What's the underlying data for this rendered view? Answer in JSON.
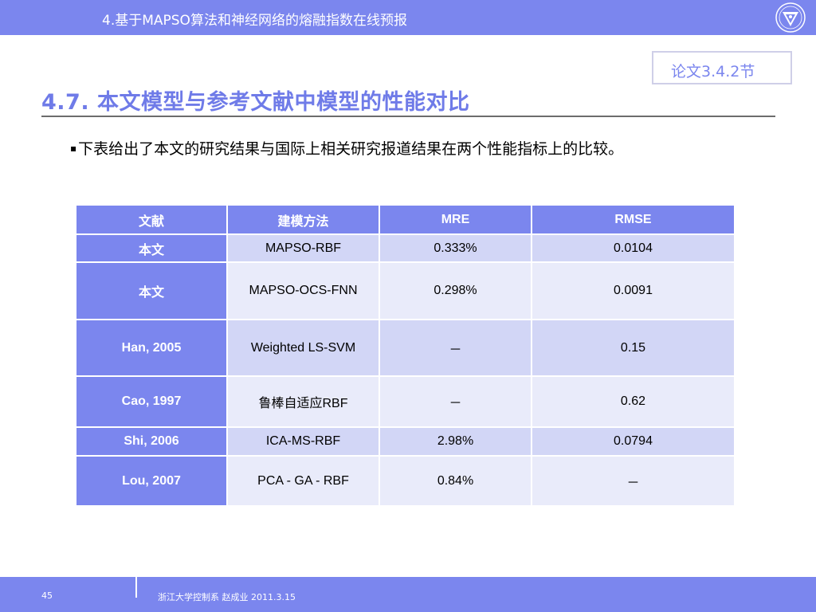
{
  "header": {
    "title": "4.基于MAPSO算法和神经网络的熔融指数在线预报",
    "logo_icon": "university-seal-icon"
  },
  "reference_tag": "论文3.4.2节",
  "heading": "4.7. 本文模型与参考文献中模型的性能对比",
  "bullet": {
    "marker": "▪",
    "text": "下表给出了本文的研究结果与国际上相关研究报道结果在两个性能指标上的比较。"
  },
  "table": {
    "headers": [
      "文献",
      "建模方法",
      "MRE",
      "RMSE"
    ],
    "rows": [
      {
        "source": "本文",
        "method": "MAPSO-RBF",
        "mre": "0.333%",
        "rmse": "0.0104"
      },
      {
        "source": "本文",
        "method": "MAPSO-OCS-FNN",
        "mre": "0.298%",
        "rmse": "0.0091"
      },
      {
        "source": "Han, 2005",
        "method": "Weighted LS-SVM",
        "mre": "－",
        "rmse": "0.15"
      },
      {
        "source": "Cao, 1997",
        "method": "鲁棒自适应RBF",
        "mre": "－",
        "rmse": "0.62"
      },
      {
        "source": "Shi, 2006",
        "method": "ICA-MS-RBF",
        "mre": "2.98%",
        "rmse": "0.0794"
      },
      {
        "source": "Lou, 2007",
        "method": "PCA - GA - RBF",
        "mre": "0.84%",
        "rmse": "－"
      }
    ]
  },
  "footer": {
    "page_number": "45",
    "organization": "浙江大学控制系 赵成业 2011.3.15"
  },
  "colors": {
    "accent": "#7b86ee",
    "row_dark": "#d2d6f6",
    "row_light": "#e9ebfa"
  }
}
